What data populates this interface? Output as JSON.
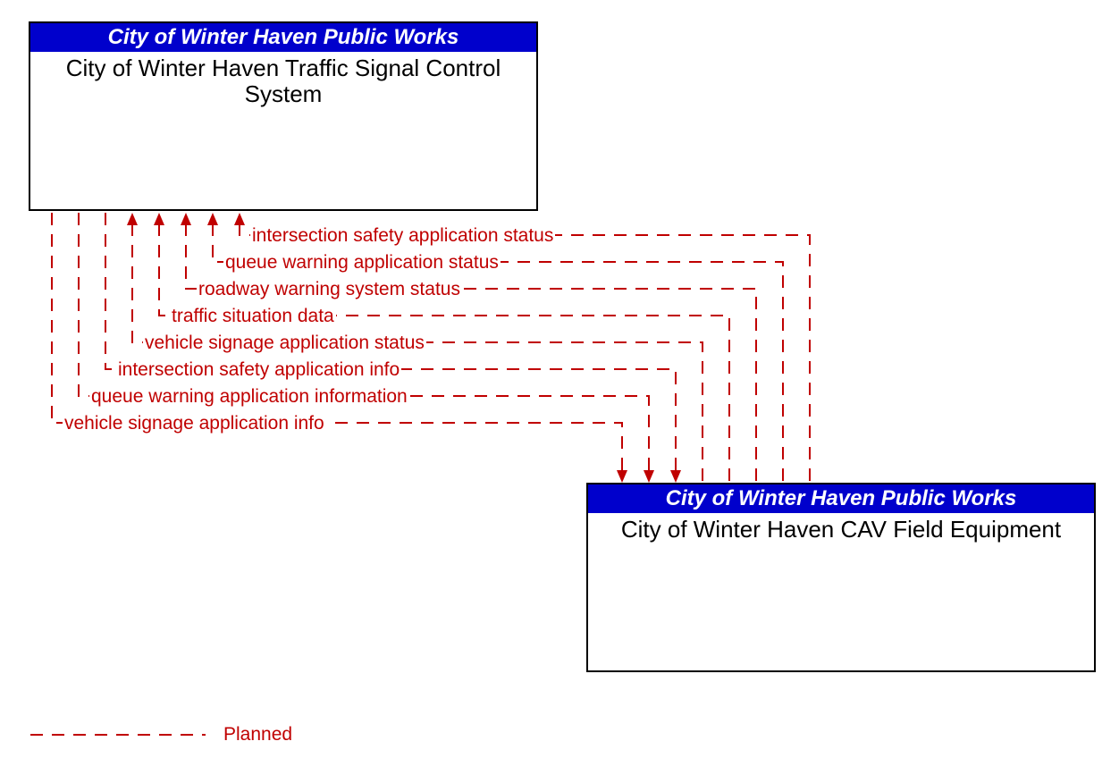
{
  "entities": {
    "top": {
      "owner": "City of Winter Haven Public Works",
      "name": "City of Winter Haven Traffic Signal Control System"
    },
    "bottom": {
      "owner": "City of Winter Haven Public Works",
      "name": "City of Winter Haven CAV Field Equipment"
    }
  },
  "flows": {
    "to_top": [
      "intersection safety application status",
      "queue warning application status",
      "roadway warning system status",
      "traffic situation data",
      "vehicle signage application status"
    ],
    "to_bottom": [
      "intersection safety application info",
      "queue warning application information",
      "vehicle signage application info"
    ]
  },
  "legend": {
    "planned": "Planned"
  },
  "colors": {
    "header_bg": "#0000cc",
    "flow": "#c00000"
  }
}
